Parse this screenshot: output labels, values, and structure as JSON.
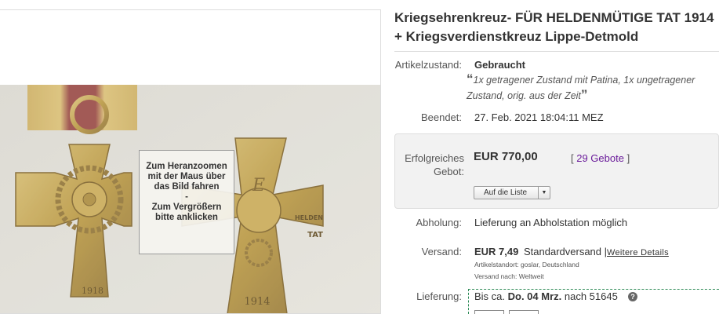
{
  "image": {
    "zoom_hint_line1": "Zum Heranzoomen mit der Maus über das Bild fahren",
    "zoom_hint_separator": "-",
    "zoom_hint_line2": "Zum Vergrößern bitte anklicken",
    "medal_left_year": "1918",
    "medal_right_year": "1914",
    "medal_right_text_top": "HELDEN",
    "medal_right_text_bottom": "TAT"
  },
  "listing": {
    "title": "Kriegsehrenkreuz- FÜR HELDENMÜTIGE TAT 1914 + Kriegsverdienstkreuz Lippe-Detmold",
    "condition_label": "Artikelzustand:",
    "condition_value": "Gebraucht",
    "condition_note": "1x getragener Zustand mit Patina, 1x ungetragener Zustand, orig. aus der Zeit",
    "quote_open": "“",
    "quote_close": "”",
    "ended_label": "Beendet:",
    "ended_value": "27. Feb. 2021  18:04:11 MEZ"
  },
  "bid": {
    "label": "Erfolgreiches Gebot:",
    "price": "EUR 770,00",
    "bids_open": "[ ",
    "bids_count": "29 Gebote",
    "bids_close": " ]",
    "watch_button": "Auf die Liste",
    "watch_arrow": "▼"
  },
  "pickup": {
    "label": "Abholung:",
    "value": "Lieferung an Abholstation möglich"
  },
  "shipping": {
    "label": "Versand:",
    "price": "EUR 7,49",
    "method": "Standardversand |",
    "more_link": "Weitere Details",
    "location_line": "Artikelstandort:  goslar, Deutschland",
    "destination_line": "Versand nach:  Weltweit"
  },
  "delivery": {
    "label": "Lieferung:",
    "prefix": "Bis ca. ",
    "date": "Do. 04 Mrz.",
    "suffix": " nach 51645",
    "help": "?"
  },
  "colors": {
    "link_purple": "#6a1b9a",
    "gold": "#b8963e",
    "delivery_border": "#2e8b57"
  }
}
